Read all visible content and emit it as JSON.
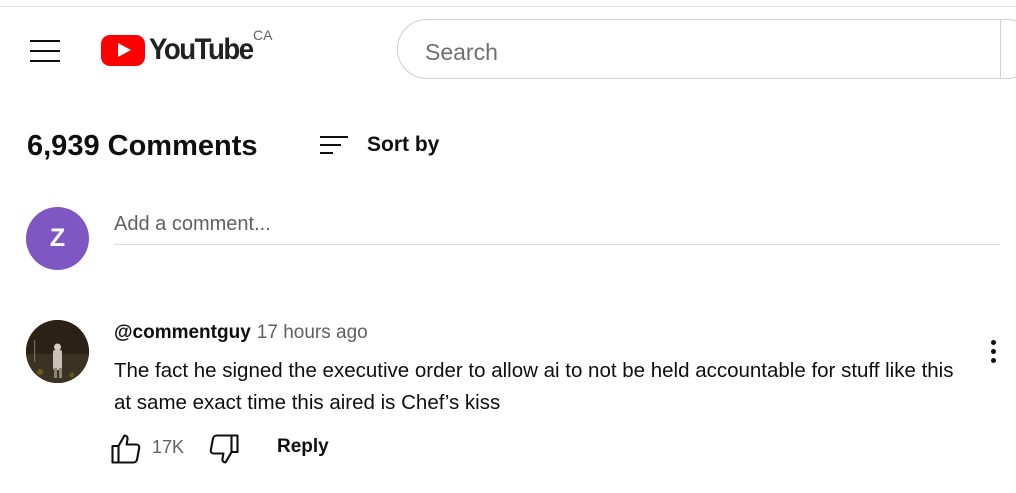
{
  "header": {
    "logo_text": "YouTube",
    "region": "CA",
    "search_placeholder": "Search",
    "brand_color": "#ff0000"
  },
  "comments_section": {
    "count_label": "6,939 Comments",
    "sort_label": "Sort by",
    "add_comment_placeholder": "Add a comment...",
    "current_user_initial": "Z",
    "current_user_avatar_color": "#7e57c2"
  },
  "comments": [
    {
      "author": "@commentguy",
      "time": "17 hours ago",
      "text": "The fact he signed the executive order to allow ai to not be held accountable for stuff like this at same exact time this aired is Chef’s kiss",
      "likes": "17K",
      "reply_label": "Reply"
    }
  ],
  "icons": {
    "menu": "hamburger-menu-icon",
    "sort": "sort-lines-icon",
    "like": "thumbs-up-icon",
    "dislike": "thumbs-down-icon",
    "more": "three-dots-vertical-icon"
  }
}
